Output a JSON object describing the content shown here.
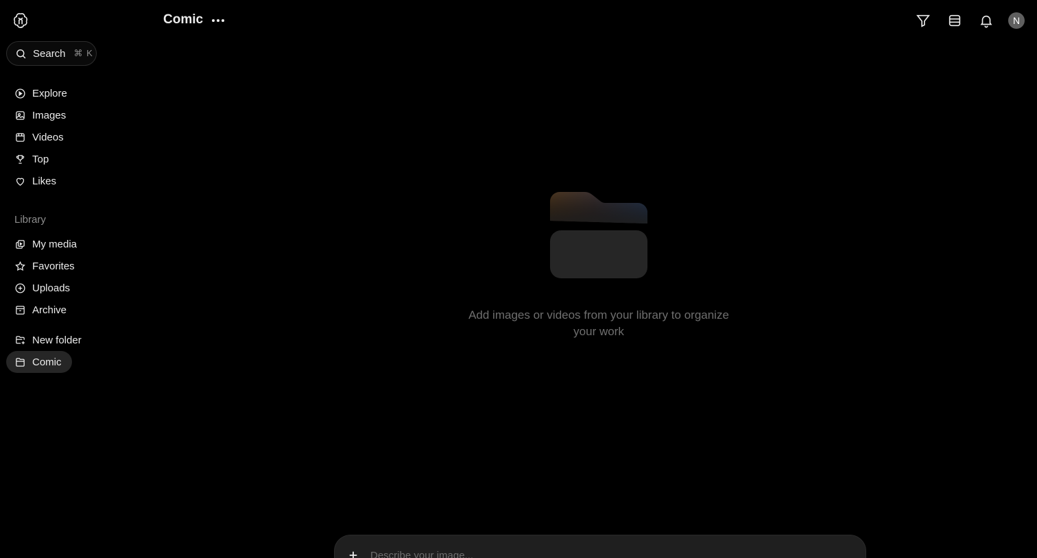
{
  "sidebar": {
    "search": {
      "label": "Search",
      "shortcut": "⌘ K"
    },
    "nav": [
      {
        "label": "Explore",
        "icon": "play-circle-icon"
      },
      {
        "label": "Images",
        "icon": "image-icon"
      },
      {
        "label": "Videos",
        "icon": "video-icon"
      },
      {
        "label": "Top",
        "icon": "trophy-icon"
      },
      {
        "label": "Likes",
        "icon": "heart-icon"
      }
    ],
    "library_label": "Library",
    "library": [
      {
        "label": "My media",
        "icon": "media-icon"
      },
      {
        "label": "Favorites",
        "icon": "star-icon"
      },
      {
        "label": "Uploads",
        "icon": "upload-icon"
      },
      {
        "label": "Archive",
        "icon": "archive-icon"
      }
    ],
    "folders": [
      {
        "label": "New folder",
        "icon": "new-folder-icon"
      },
      {
        "label": "Comic",
        "icon": "folder-icon",
        "active": true
      }
    ]
  },
  "header": {
    "title": "Comic",
    "avatar_initial": "N"
  },
  "empty_state": {
    "message": "Add images or videos from your library to organize your work"
  },
  "prompt": {
    "placeholder": "Describe your image..."
  }
}
